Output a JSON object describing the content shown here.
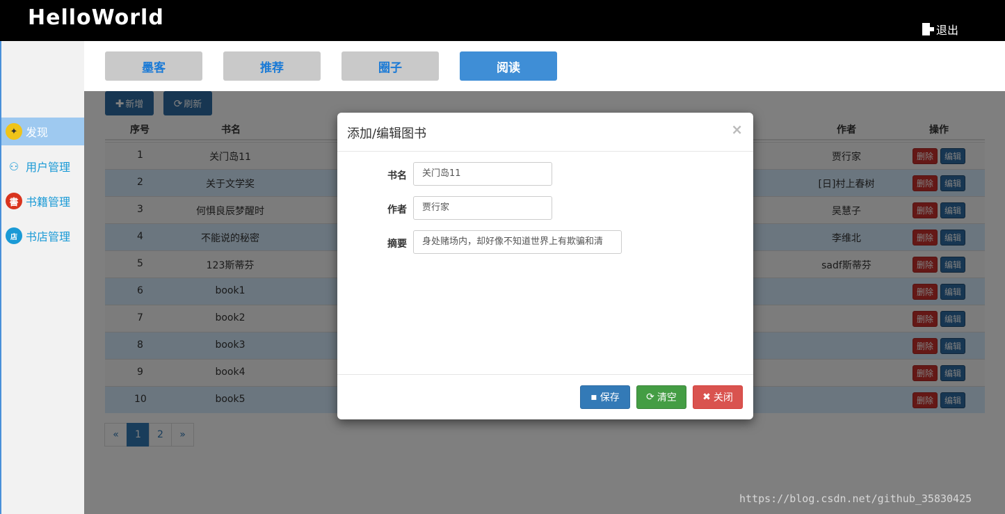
{
  "header": {
    "logo": "HelloWorld",
    "logout_label": "退出"
  },
  "sidebar": {
    "items": [
      {
        "label": "发现",
        "icon": "compass-icon",
        "active": true
      },
      {
        "label": "用户管理",
        "icon": "users-icon",
        "active": false
      },
      {
        "label": "书籍管理",
        "icon": "book-icon",
        "active": false
      },
      {
        "label": "书店管理",
        "icon": "store-icon",
        "active": false
      }
    ]
  },
  "tabs": [
    {
      "label": "墨客",
      "active": false
    },
    {
      "label": "推荐",
      "active": false
    },
    {
      "label": "圈子",
      "active": false
    },
    {
      "label": "阅读",
      "active": true
    }
  ],
  "toolbar": {
    "add_label": "新增",
    "refresh_label": "刷新"
  },
  "table": {
    "columns": {
      "index": "序号",
      "name": "书名",
      "author": "作者",
      "actions": "操作"
    },
    "delete_label": "删除",
    "edit_label": "编辑",
    "rows": [
      {
        "index": "1",
        "name": "关门岛11",
        "author": "贾行家"
      },
      {
        "index": "2",
        "name": "关于文学奖",
        "author": "[日]村上春树"
      },
      {
        "index": "3",
        "name": "何惧良辰梦醒时",
        "author": "吴慧子"
      },
      {
        "index": "4",
        "name": "不能说的秘密",
        "author": "李维北"
      },
      {
        "index": "5",
        "name": "123斯蒂芬",
        "author": "sadf斯蒂芬"
      },
      {
        "index": "6",
        "name": "book1",
        "author": ""
      },
      {
        "index": "7",
        "name": "book2",
        "author": ""
      },
      {
        "index": "8",
        "name": "book3",
        "author": ""
      },
      {
        "index": "9",
        "name": "book4",
        "author": ""
      },
      {
        "index": "10",
        "name": "book5",
        "author": ""
      }
    ]
  },
  "pagination": {
    "prev": "«",
    "pages": [
      "1",
      "2"
    ],
    "current": "1",
    "next": "»"
  },
  "modal": {
    "title": "添加/编辑图书",
    "close": "×",
    "fields": {
      "name_label": "书名",
      "name_value": "关门岛11",
      "author_label": "作者",
      "author_value": "贾行家",
      "summary_label": "摘要",
      "summary_value": "身处赌场内，却好像不知道世界上有欺骗和清"
    },
    "save_label": "保存",
    "clear_label": "清空",
    "close_label": "关闭"
  },
  "watermark": "https://blog.csdn.net/github_35830425",
  "colors": {
    "primary": "#2e6da4",
    "danger": "#c9302c",
    "success": "#449d44",
    "tab_active": "#3f8ed6",
    "link": "#1a9ad6"
  }
}
